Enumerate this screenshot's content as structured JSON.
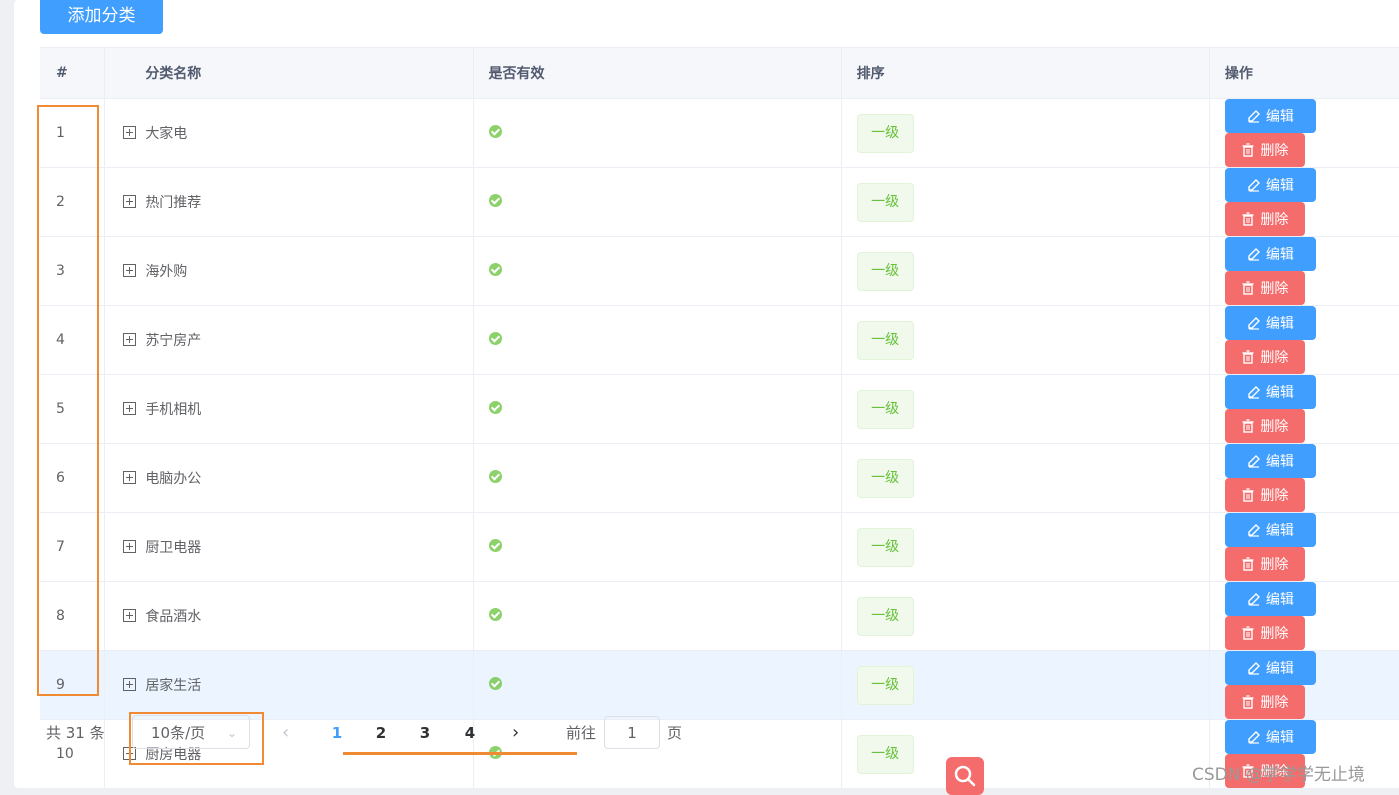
{
  "toolbar": {
    "add_label": "添加分类"
  },
  "table": {
    "headers": {
      "index": "#",
      "name": "分类名称",
      "valid": "是否有效",
      "sort": "排序",
      "ops": "操作"
    },
    "rows": [
      {
        "index": "1",
        "name": "大家电",
        "level": "一级"
      },
      {
        "index": "2",
        "name": "热门推荐",
        "level": "一级"
      },
      {
        "index": "3",
        "name": "海外购",
        "level": "一级"
      },
      {
        "index": "4",
        "name": "苏宁房产",
        "level": "一级"
      },
      {
        "index": "5",
        "name": "手机相机",
        "level": "一级"
      },
      {
        "index": "6",
        "name": "电脑办公",
        "level": "一级"
      },
      {
        "index": "7",
        "name": "厨卫电器",
        "level": "一级"
      },
      {
        "index": "8",
        "name": "食品酒水",
        "level": "一级"
      },
      {
        "index": "9",
        "name": "居家生活",
        "level": "一级"
      },
      {
        "index": "10",
        "name": "厨房电器",
        "level": "一级"
      }
    ],
    "edit_label": "编辑",
    "delete_label": "删除"
  },
  "pagination": {
    "total": "共 31 条",
    "page_size": "10条/页",
    "pages": [
      "1",
      "2",
      "3",
      "4"
    ],
    "current_page": "1",
    "goto_label": "前往",
    "goto_value": "1",
    "page_unit": "页"
  },
  "watermark": "CSDN @学学学无止境",
  "colors": {
    "primary": "#409eff",
    "danger": "#f56c6c",
    "success": "#67c23a",
    "annotation": "#f08a33"
  }
}
